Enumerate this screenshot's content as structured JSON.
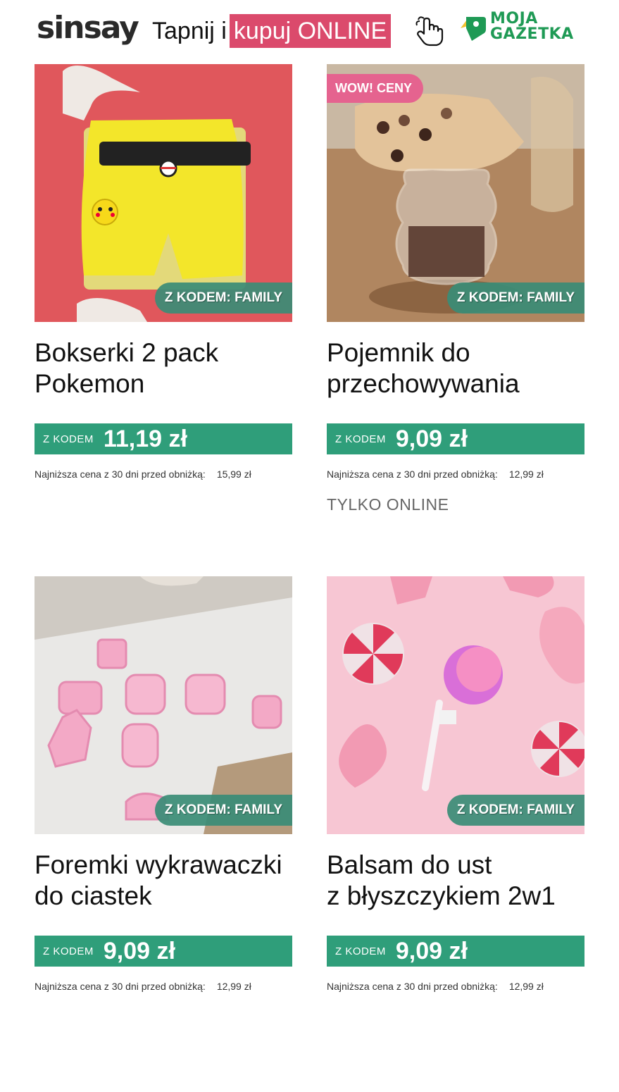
{
  "header": {
    "brand": "sinsay",
    "tagline_plain": "Tapnij i",
    "tagline_highlight": "kupuj ONLINE",
    "partner_line1": "MOJA",
    "partner_line2": "GAZETKA",
    "hand_icon": "pointer-hand-icon",
    "partner_icon": "moja-gazetka-logo",
    "colors": {
      "highlight": "#db4a6c",
      "partner": "#1f9a55",
      "price_bar": "#2f9e7a"
    }
  },
  "products": [
    {
      "title_line1": "Bokserki 2 pack",
      "title_line2": "Pokemon",
      "badge_code": "Z KODEM: FAMILY",
      "price_prefix": "Z KODEM",
      "price": "11,19 zł",
      "lowest_label": "Najniższa cena z 30 dni przed obniżką:",
      "lowest_value": "15,99 zł"
    },
    {
      "badge_wow": "WOW! CENY",
      "title_line1": "Pojemnik do",
      "title_line2": "przechowywania",
      "badge_code": "Z KODEM: FAMILY",
      "price_prefix": "Z KODEM",
      "price": "9,09 zł",
      "lowest_label": "Najniższa cena z 30 dni przed obniżką:",
      "lowest_value": "12,99 zł",
      "note": "TYLKO ONLINE"
    },
    {
      "title_line1": "Foremki wykrawaczki",
      "title_line2": "do ciastek",
      "badge_code": "Z KODEM: FAMILY",
      "price_prefix": "Z KODEM",
      "price": "9,09 zł",
      "lowest_label": "Najniższa cena z 30 dni przed obniżką:",
      "lowest_value": "12,99 zł"
    },
    {
      "title_line1": "Balsam do ust",
      "title_line2": "z błyszczykiem 2w1",
      "badge_code": "Z KODEM: FAMILY",
      "price_prefix": "Z KODEM",
      "price": "9,09 zł",
      "lowest_label": "Najniższa cena z 30 dni przed obniżką:",
      "lowest_value": "12,99 zł"
    }
  ]
}
